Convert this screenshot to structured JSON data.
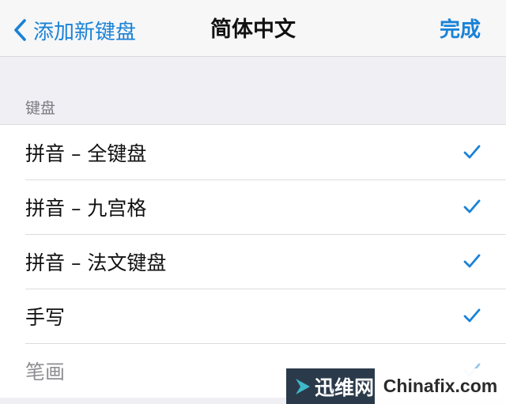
{
  "nav": {
    "back_label": "添加新键盘",
    "title": "简体中文",
    "done_label": "完成"
  },
  "section": {
    "header": "键盘"
  },
  "keyboards": [
    {
      "label": "拼音 – 全键盘",
      "checked": true
    },
    {
      "label": "拼音 – 九宫格",
      "checked": true
    },
    {
      "label": "拼音 – 法文键盘",
      "checked": true
    },
    {
      "label": "手写",
      "checked": true
    },
    {
      "label": "笔画",
      "checked": true
    }
  ],
  "watermark": {
    "brand_cn": "迅维网",
    "brand_en": "Chinafix.com"
  },
  "colors": {
    "accent": "#1a82d6",
    "background": "#efeff4",
    "watermark_dark": "#2b3a4a",
    "watermark_arrow": "#3fb8c9"
  },
  "icons": {
    "back": "chevron-left-icon",
    "check": "checkmark-icon"
  }
}
